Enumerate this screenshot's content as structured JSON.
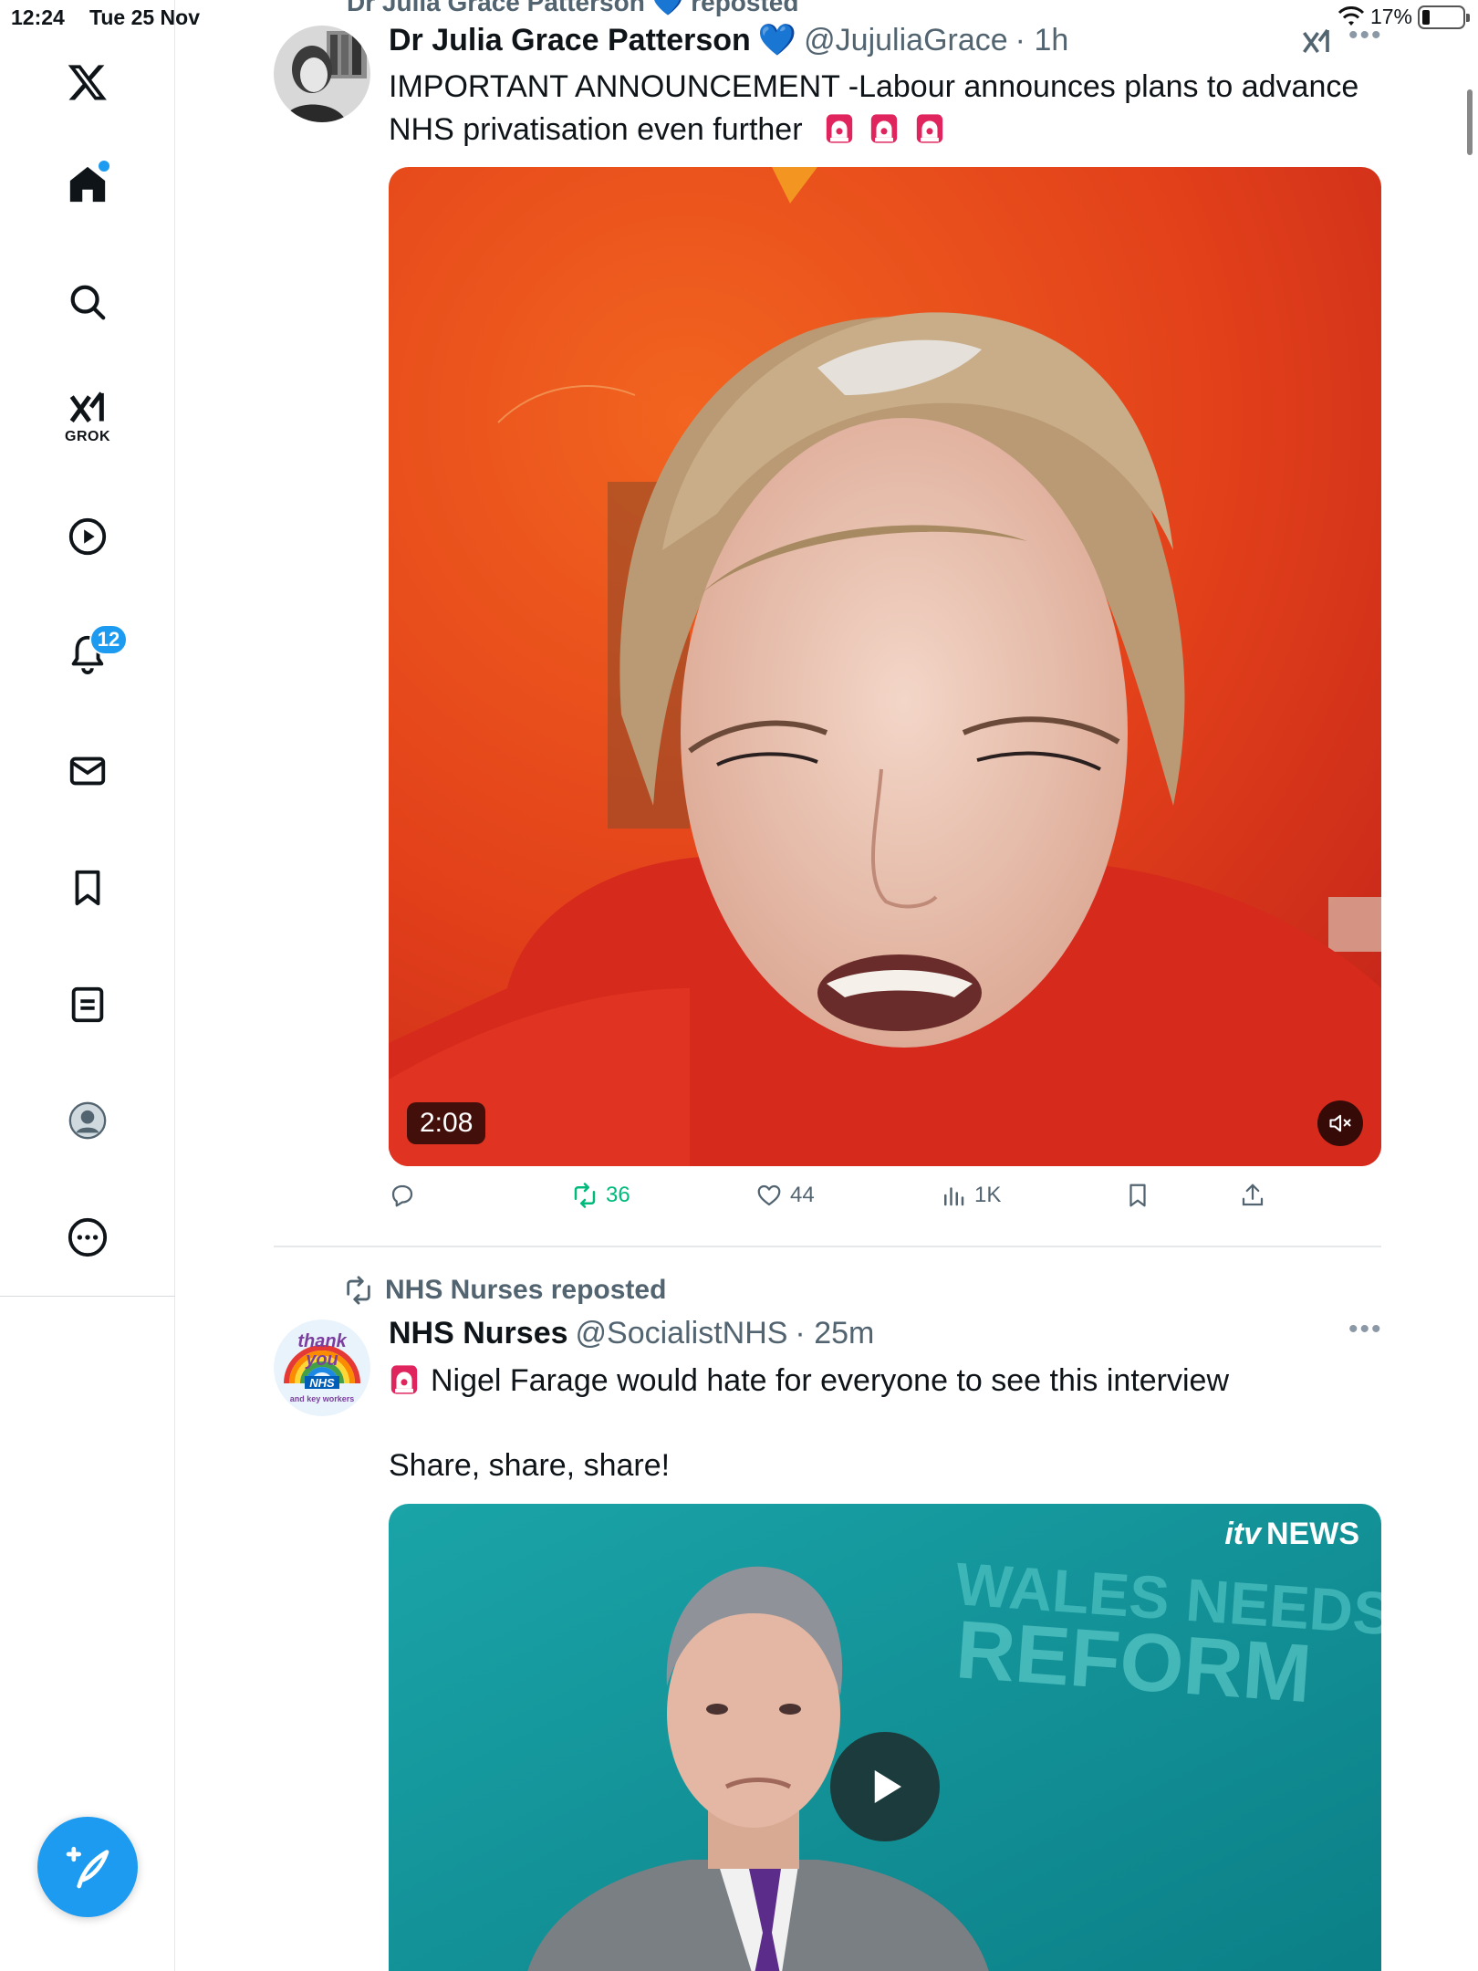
{
  "status_bar": {
    "time": "12:24",
    "date": "Tue 25 Nov",
    "battery": "17%"
  },
  "sidebar": {
    "notifications_badge": "12",
    "grok_label": "GROK"
  },
  "top_partial_repost": "Dr Julia Grace Patterson 💙 reposted",
  "tweet1": {
    "name": "Dr Julia Grace Patterson",
    "badge": "💙",
    "handle": "@JujuliaGrace",
    "time": "· 1h",
    "text_line1": "IMPORTANT ANNOUNCEMENT -Labour announces plans to advance",
    "text_line2": "NHS privatisation even further",
    "video_duration": "2:08",
    "reposts": "36",
    "likes": "44",
    "views": "1K"
  },
  "tweet2": {
    "reposted_by": "NHS Nurses reposted",
    "name": "NHS Nurses",
    "handle": "@SocialistNHS",
    "time": "· 25m",
    "text_line1": "Nigel Farage would hate for everyone to see this interview",
    "text_line2": "Share, share, share!",
    "avatar_text_1": "thank",
    "avatar_text_2": "you",
    "avatar_text_3": "NHS",
    "avatar_text_4": "and key workers",
    "video_brand_itv": "itv",
    "video_brand_news": "NEWS",
    "video_backdrop_1": "WALES NEEDS",
    "video_backdrop_2": "REFORM"
  },
  "colors": {
    "accent": "#1d9bf0",
    "repost_green": "#00ba7c",
    "muted": "#536471"
  },
  "icons": [
    "x-logo-icon",
    "home-icon",
    "search-icon",
    "grok-icon",
    "video-icon",
    "bell-icon",
    "mail-icon",
    "bookmark-icon",
    "list-icon",
    "profile-icon",
    "more-icon",
    "compose-icon",
    "reply-icon",
    "repost-icon",
    "like-icon",
    "views-icon",
    "share-icon",
    "siren-icon",
    "mute-icon",
    "play-icon"
  ]
}
